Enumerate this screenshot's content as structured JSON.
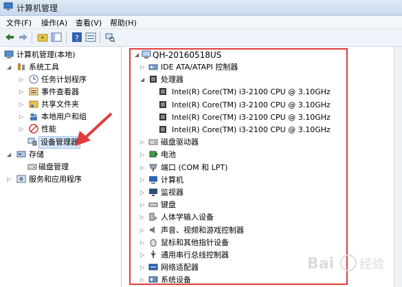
{
  "window": {
    "title": "计算机管理"
  },
  "menu": [
    "文件(F)",
    "操作(A)",
    "查看(V)",
    "帮助(H)"
  ],
  "left_tree": {
    "root": "计算机管理(本地)",
    "system_tools": "系统工具",
    "task_scheduler": "任务计划程序",
    "event_viewer": "事件查看器",
    "shared_folders": "共享文件夹",
    "local_users": "本地用户和组",
    "performance": "性能",
    "device_manager": "设备管理器",
    "storage": "存储",
    "disk_management": "磁盘管理",
    "services_apps": "服务和应用程序"
  },
  "device_tree": {
    "computer_name": "QH-20160518US",
    "categories": [
      {
        "label": "IDE ATA/ATAPI 控制器",
        "icon": "ide-controller-icon"
      },
      {
        "label": "处理器",
        "icon": "processor-icon",
        "expanded": true,
        "children": [
          "Intel(R) Core(TM) i3-2100 CPU @ 3.10GHz",
          "Intel(R) Core(TM) i3-2100 CPU @ 3.10GHz",
          "Intel(R) Core(TM) i3-2100 CPU @ 3.10GHz",
          "Intel(R) Core(TM) i3-2100 CPU @ 3.10GHz"
        ]
      },
      {
        "label": "磁盘驱动器",
        "icon": "disk-drive-icon"
      },
      {
        "label": "电池",
        "icon": "battery-icon"
      },
      {
        "label": "端口 (COM 和 LPT)",
        "icon": "port-icon"
      },
      {
        "label": "计算机",
        "icon": "computer-icon"
      },
      {
        "label": "监视器",
        "icon": "monitor-icon"
      },
      {
        "label": "键盘",
        "icon": "keyboard-icon"
      },
      {
        "label": "人体学输入设备",
        "icon": "hid-icon"
      },
      {
        "label": "声音、视频和游戏控制器",
        "icon": "sound-icon"
      },
      {
        "label": "鼠标和其他指针设备",
        "icon": "mouse-icon"
      },
      {
        "label": "通用串行总线控制器",
        "icon": "usb-icon"
      },
      {
        "label": "网络适配器",
        "icon": "network-adapter-icon"
      },
      {
        "label": "系统设备",
        "icon": "system-device-icon"
      }
    ]
  },
  "watermark": "Baidu 经验",
  "colors": {
    "highlight_box": "#e23a3a",
    "arrow": "#e23a3a",
    "selection": "#d5e5f7"
  }
}
